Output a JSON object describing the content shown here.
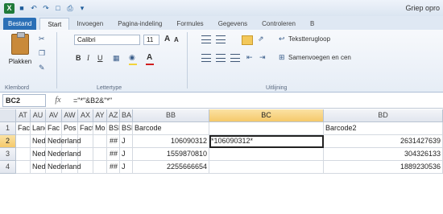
{
  "window": {
    "title": "Griep opro"
  },
  "quick_access": {
    "icons": [
      "excel-logo",
      "save-icon",
      "undo-icon",
      "redo-icon",
      "new-icon",
      "print-icon",
      "customize-icon"
    ]
  },
  "tabs": [
    {
      "label": "Bestand"
    },
    {
      "label": "Start"
    },
    {
      "label": "Invoegen"
    },
    {
      "label": "Pagina-indeling"
    },
    {
      "label": "Formules"
    },
    {
      "label": "Gegevens"
    },
    {
      "label": "Controleren"
    },
    {
      "label": "B"
    }
  ],
  "ribbon": {
    "paste_label": "Plakken",
    "font_name": "Calibri",
    "font_size": "11",
    "grow_label": "A",
    "shrink_label": "A",
    "bold_label": "B",
    "italic_label": "I",
    "underline_label": "U",
    "color_label": "A",
    "wrap_text": "Tekstterugloop",
    "merge_text": "Samenvoegen en cen",
    "groups": {
      "clipboard": "Klembord",
      "font": "Lettertype",
      "alignment": "Uitlijning"
    },
    "fill_color": "#f3d43a",
    "font_color": "#d11f1f"
  },
  "formula_bar": {
    "name_box": "BC2",
    "fx": "fx",
    "formula": "=\"*\"&B2&\"*\""
  },
  "grid": {
    "columns": [
      "AT",
      "AU",
      "AV",
      "AW",
      "AX",
      "AY",
      "AZ",
      "BA",
      "BB",
      "BC",
      "BD"
    ],
    "rows": [
      {
        "num": "1",
        "cells": [
          "Fac",
          "Lanc",
          "Fac",
          "Pos",
          "Fact",
          "Mo",
          "BSN",
          "BSN",
          "Barcode",
          "",
          "Barcode2"
        ]
      },
      {
        "num": "2",
        "cells": [
          "",
          "Ned",
          "Nederland",
          "",
          "",
          "",
          "##",
          "J",
          "106090312",
          "*106090312*",
          "2631427639"
        ]
      },
      {
        "num": "3",
        "cells": [
          "",
          "Ned",
          "Nederland",
          "",
          "",
          "",
          "##",
          "J",
          "1559870810",
          "",
          "304326133"
        ]
      },
      {
        "num": "4",
        "cells": [
          "",
          "Ned",
          "Nederland",
          "",
          "",
          "",
          "##",
          "J",
          "2255666654",
          "",
          "1889230536"
        ]
      }
    ],
    "active_cell": "BC2"
  }
}
